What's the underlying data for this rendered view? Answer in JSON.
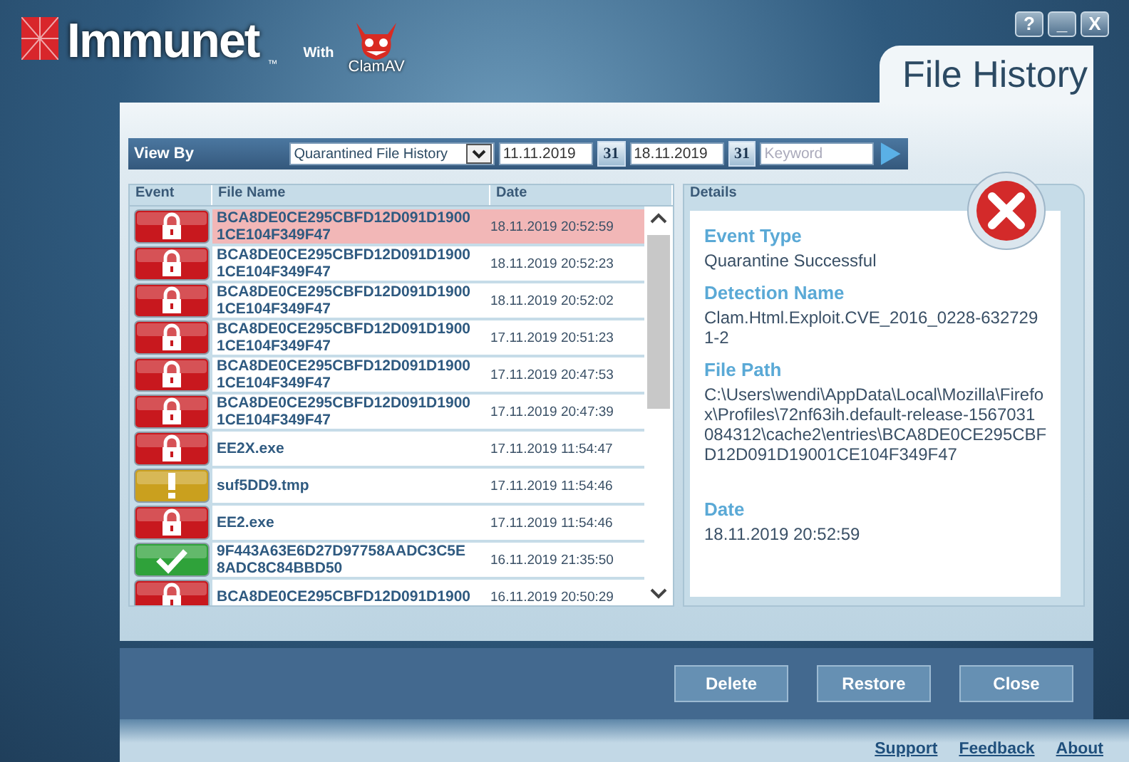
{
  "app": {
    "logo": "Immunet",
    "trademark": "™",
    "with": "With",
    "partner": "ClamAV"
  },
  "window_controls": [
    {
      "kind": "help",
      "label": "?"
    },
    {
      "kind": "minimize",
      "label": "_"
    },
    {
      "kind": "close",
      "label": "X"
    }
  ],
  "title": "File History",
  "toolbar": {
    "label": "View By",
    "view_select": "Quarantined File History",
    "start_date": "11.11.2019",
    "start_calendar": "31",
    "end_date": "18.11.2019",
    "end_calendar": "31",
    "search": {
      "placeholder": "Keyword"
    }
  },
  "table": {
    "columns": [
      "Event",
      "File Name",
      "Date"
    ],
    "rows": [
      {
        "kind": "quarantined",
        "selected": true,
        "file_lines": [
          "BCA8DE0CE295CBFD12D091D1900",
          "1CE104F349F47"
        ],
        "date": "18.11.2019 20:52:59"
      },
      {
        "kind": "quarantined",
        "selected": false,
        "file_lines": [
          "BCA8DE0CE295CBFD12D091D1900",
          "1CE104F349F47"
        ],
        "date": "18.11.2019 20:52:23"
      },
      {
        "kind": "quarantined",
        "selected": false,
        "file_lines": [
          "BCA8DE0CE295CBFD12D091D1900",
          "1CE104F349F47"
        ],
        "date": "18.11.2019 20:52:02"
      },
      {
        "kind": "quarantined",
        "selected": false,
        "file_lines": [
          "BCA8DE0CE295CBFD12D091D1900",
          "1CE104F349F47"
        ],
        "date": "17.11.2019 20:51:23"
      },
      {
        "kind": "quarantined",
        "selected": false,
        "file_lines": [
          "BCA8DE0CE295CBFD12D091D1900",
          "1CE104F349F47"
        ],
        "date": "17.11.2019 20:47:53"
      },
      {
        "kind": "quarantined",
        "selected": false,
        "file_lines": [
          "BCA8DE0CE295CBFD12D091D1900",
          "1CE104F349F47"
        ],
        "date": "17.11.2019 20:47:39"
      },
      {
        "kind": "quarantined",
        "selected": false,
        "file_lines": [
          "EE2X.exe"
        ],
        "date": "17.11.2019 11:54:47"
      },
      {
        "kind": "warning",
        "selected": false,
        "file_lines": [
          "suf5DD9.tmp"
        ],
        "date": "17.11.2019 11:54:46"
      },
      {
        "kind": "quarantined",
        "selected": false,
        "file_lines": [
          "EE2.exe"
        ],
        "date": "17.11.2019 11:54:46"
      },
      {
        "kind": "clean",
        "selected": false,
        "file_lines": [
          "9F443A63E6D27D97758AADC3C5E",
          "8ADC8C84BBD50"
        ],
        "date": "16.11.2019 21:35:50"
      },
      {
        "kind": "quarantined",
        "selected": false,
        "file_lines": [
          "BCA8DE0CE295CBFD12D091D1900"
        ],
        "date": "16.11.2019 20:50:29"
      }
    ]
  },
  "details": {
    "title": "Details",
    "fields": [
      {
        "label": "Event Type",
        "lines": [
          "Quarantine Successful"
        ]
      },
      {
        "label": "Detection Name",
        "lines": [
          "Clam.Html.Exploit.CVE_2016_0228-632729",
          "1-2"
        ]
      },
      {
        "label": "File Path",
        "lines": [
          "C:\\Users\\wendi\\AppData\\Local\\Mozilla\\Firefo",
          "x\\Profiles\\72nf63ih.default-release-1567031",
          "084312\\cache2\\entries\\BCA8DE0CE295CBF",
          "D12D091D19001CE104F349F47"
        ]
      },
      {
        "label": "Date",
        "lines": [
          "18.11.2019 20:52:59"
        ]
      }
    ]
  },
  "buttons": [
    "Delete",
    "Restore",
    "Close"
  ],
  "links": [
    "Support",
    "Feedback",
    "About"
  ]
}
